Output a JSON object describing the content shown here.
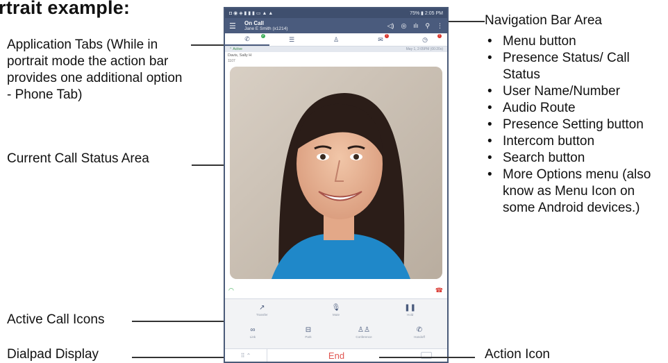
{
  "heading": "rtrait example:",
  "left_labels": {
    "application_tabs": "Application Tabs (While in portrait mode the action bar provides one additional option - Phone Tab)",
    "current_call_status": "Current Call Status Area",
    "active_call_icons": "Active Call Icons",
    "dialpad_display": "Dialpad Display"
  },
  "right_labels": {
    "navigation_bar": "Navigation Bar Area",
    "action_icon": "Action Icon",
    "features": [
      "Menu button",
      "Presence Status/ Call Status",
      "User Name/Number",
      "Audio Route",
      "Presence Setting button",
      "Intercom button",
      "Search button",
      "More Options menu (also know as Menu Icon on some Android devices.)"
    ]
  },
  "phone": {
    "status_time": "75% ▮ 2:05 PM",
    "nav": {
      "title": "On Call",
      "subtitle": "Jane E Smith (x1214)",
      "icons": [
        "speaker-icon",
        "location-icon",
        "intercom-icon",
        "search-icon",
        "more-options-icon"
      ]
    },
    "tabs": [
      "phone-tab",
      "list-tab",
      "contacts-tab",
      "messages-tab",
      "history-tab"
    ],
    "active_label": "Active",
    "active_date": "May 1, 2:05PM (00:20s)",
    "caller_name": "Davis, Sally H",
    "caller_ext": "1107",
    "call_icons": [
      {
        "label": "Transfer",
        "icon": "transfer-icon"
      },
      {
        "label": "Mute",
        "icon": "mute-icon"
      },
      {
        "label": "Hold",
        "icon": "hold-icon"
      },
      {
        "label": "Link",
        "icon": "link-icon"
      },
      {
        "label": "Park",
        "icon": "park-icon"
      },
      {
        "label": "Conference",
        "icon": "conference-icon"
      },
      {
        "label": "Handoff",
        "icon": "handoff-icon"
      }
    ],
    "end_label": "End"
  },
  "colors": {
    "nav_bar": "#4a5b7d",
    "end_red": "#e05550",
    "badge_green": "#3cae5a",
    "badge_red": "#d8332b"
  }
}
